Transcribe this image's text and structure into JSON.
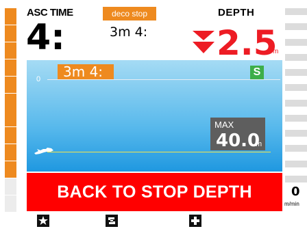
{
  "header": {
    "asc_time_label": "ASC TIME",
    "asc_time_value": "4:",
    "deco_stop_label": "deco stop",
    "deco_stop_value": "3m 4:",
    "depth_label": "DEPTH",
    "depth_value": "2.5",
    "depth_unit": "m"
  },
  "profile": {
    "surface_label": "0",
    "stop_badge": "3m 4:",
    "status_badge": "S",
    "max_label": "MAX",
    "max_value": "40.0",
    "max_unit": "m"
  },
  "warning": {
    "text": "BACK TO STOP DEPTH"
  },
  "rate": {
    "value": "0",
    "unit": "m/min",
    "ascent_segments_lit": 10,
    "ascent_segments_total": 12
  },
  "buttons": [
    {
      "icon": "star-icon"
    },
    {
      "icon": "swap-icon"
    },
    {
      "icon": "plus-icon"
    }
  ],
  "colors": {
    "accent_orange": "#ee8a1f",
    "alert_red": "#ff0000",
    "depth_red": "#ed1c24",
    "status_green": "#3dae49",
    "max_box_gray": "#5e5e5e"
  }
}
